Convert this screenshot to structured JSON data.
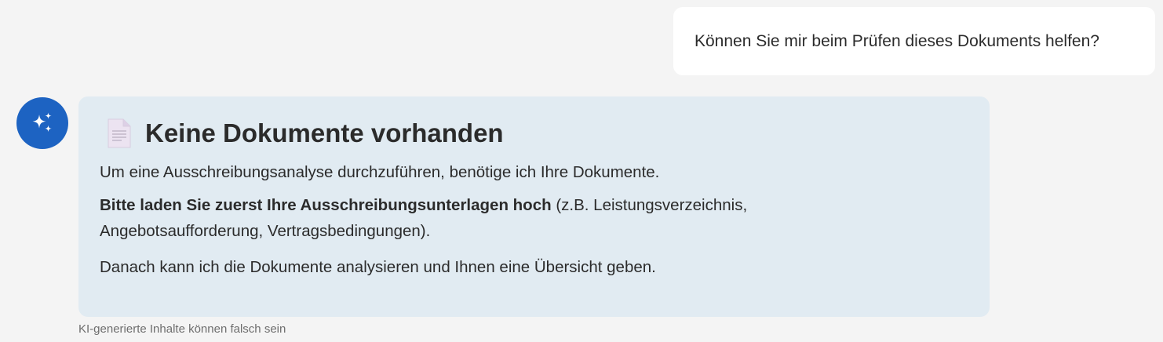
{
  "user_message": {
    "text": "Können Sie mir beim Prüfen dieses Dokuments helfen?"
  },
  "assistant": {
    "avatar_icon": "sparkles-icon",
    "doc_icon": "document-icon",
    "heading": "Keine Dokumente vorhanden",
    "paragraph1": "Um eine Ausschreibungsanalyse durchzuführen, benötige ich Ihre Dokumente.",
    "paragraph2_bold": "Bitte laden Sie zuerst Ihre Ausschreibungsunterlagen hoch",
    "paragraph2_line1_rest": " (z.B. Leistungsverzeichnis,",
    "paragraph2_line2": "Angebotsaufforderung, Vertragsbedingungen).",
    "paragraph3": "Danach kann ich die Dokumente analysieren und Ihnen eine Übersicht geben."
  },
  "disclaimer": "KI-generierte Inhalte können falsch sein",
  "colors": {
    "background": "#f4f4f4",
    "user_bubble": "#ffffff",
    "assistant_bubble": "#e1ebf2",
    "avatar": "#1d63c2"
  }
}
